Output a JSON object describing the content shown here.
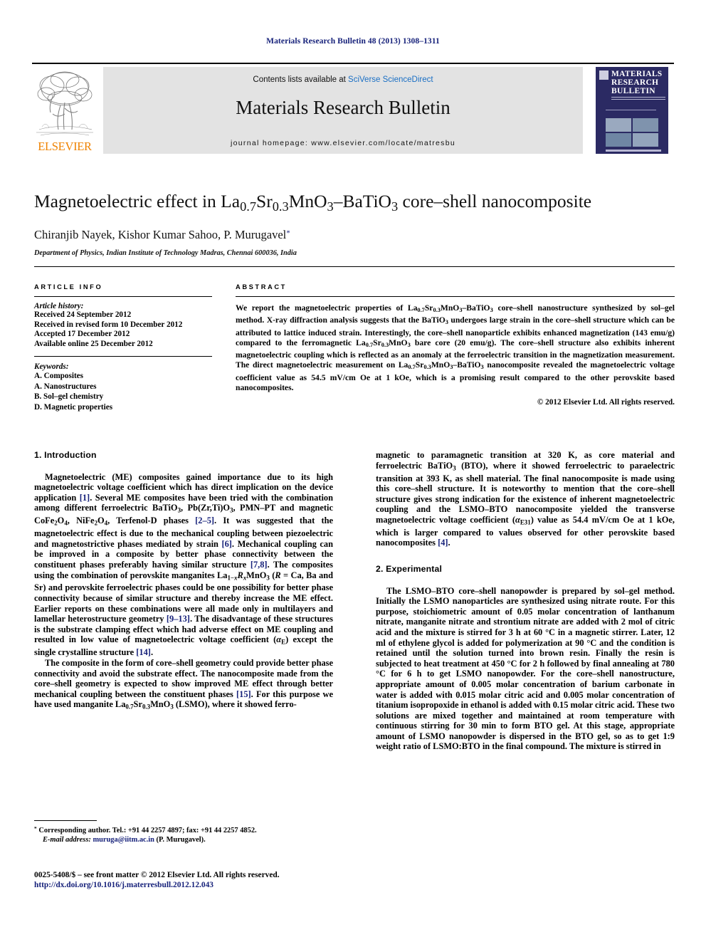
{
  "running_head": "Materials Research Bulletin 48 (2013) 1308–1311",
  "masthead": {
    "contents_prefix": "Contents lists available at ",
    "contents_link": "SciVerse ScienceDirect",
    "journal_title": "Materials Research Bulletin",
    "homepage": "journal homepage: www.elsevier.com/locate/matresbu",
    "publisher_logo_text": "ELSEVIER",
    "cover_title_line1": "MATERIALS",
    "cover_title_line2": "RESEARCH",
    "cover_title_line3": "BULLETIN"
  },
  "article": {
    "title_html": "Magnetoelectric effect in La<sub>0.7</sub>Sr<sub>0.3</sub>MnO<sub>3</sub>–BaTiO<sub>3</sub> core–shell nanocomposite",
    "authors_html": "Chiranjib Nayek, Kishor Kumar Sahoo, P. Murugavel<sup>*</sup>",
    "affiliation": "Department of Physics, Indian Institute of Technology Madras, Chennai 600036, India"
  },
  "article_info": {
    "heading": "ARTICLE INFO",
    "history_label": "Article history:",
    "history": [
      "Received 24 September 2012",
      "Received in revised form 10 December 2012",
      "Accepted 17 December 2012",
      "Available online 25 December 2012"
    ],
    "keywords_label": "Keywords:",
    "keywords": [
      "A. Composites",
      "A. Nanostructures",
      "B. Sol–gel chemistry",
      "D. Magnetic properties"
    ]
  },
  "abstract": {
    "heading": "ABSTRACT",
    "text_html": "We report the magnetoelectric properties of La<sub>0.7</sub>Sr<sub>0.3</sub>MnO<sub>3</sub>–BaTiO<sub>3</sub> core–shell nanostructure synthesized by sol–gel method. X-ray diffraction analysis suggests that the BaTiO<sub>3</sub> undergoes large strain in the core–shell structure which can be attributed to lattice induced strain. Interestingly, the core–shell nanoparticle exhibits enhanced magnetization (143 emu/g) compared to the ferromagnetic La<sub>0.7</sub>Sr<sub>0.3</sub>MnO<sub>3</sub> bare core (20 emu/g). The core–shell structure also exhibits inherent magnetoelectric coupling which is reflected as an anomaly at the ferroelectric transition in the magnetization measurement. The direct magnetoelectric measurement on La<sub>0.7</sub>Sr<sub>0.3</sub>MnO<sub>3</sub>–BaTiO<sub>3</sub> nanocomposite revealed the magnetoelectric voltage coefficient value as 54.5 mV/cm Oe at 1 kOe, which is a promising result compared to the other perovskite based nanocomposites.",
    "copyright": "© 2012 Elsevier Ltd. All rights reserved."
  },
  "sections": {
    "introduction_heading": "1. Introduction",
    "intro_p1_html": "Magnetoelectric (ME) composites gained importance due to its high magnetoelectric voltage coefficient which has direct implication on the device application <span class=\"ref\">[1]</span>. Several ME composites have been tried with the combination among different ferroelectric BaTiO<sub>3</sub>, Pb(Zr,Ti)O<sub>3</sub>, PMN–PT and magnetic CoFe<sub>2</sub>O<sub>4</sub>, NiFe<sub>2</sub>O<sub>4</sub>, Terfenol-D phases <span class=\"ref\">[2–5]</span>. It was suggested that the magnetoelectric effect is due to the mechanical coupling between piezoelectric and magnetostrictive phases mediated by strain <span class=\"ref\">[6]</span>. Mechanical coupling can be improved in a composite by better phase connectivity between the constituent phases preferably having similar structure <span class=\"ref\">[7,8]</span>. The composites using the combination of perovskite manganites La<sub>1−<i>x</i></sub><i>R<sub>x</sub></i>MnO<sub>3</sub> (<i>R</i> = Ca, Ba and Sr) and perovskite ferroelectric phases could be one possibility for better phase connectivity because of similar structure and thereby increase the ME effect. Earlier reports on these combinations were all made only in multilayers and lamellar heterostructure geometry <span class=\"ref\">[9–13]</span>. The disadvantage of these structures is the substrate clamping effect which had adverse effect on ME coupling and resulted in low value of magnetoelectric voltage coefficient (<i>α</i><sub>E</sub>) except the single crystalline structure <span class=\"ref\">[14]</span>.",
    "intro_p2_html": "The composite in the form of core–shell geometry could provide better phase connectivity and avoid the substrate effect. The nanocomposite made from the core–shell geometry is expected to show improved ME effect through better mechanical coupling between the constituent phases <span class=\"ref\">[15]</span>. For this purpose we have used manganite La<sub>0.7</sub>Sr<sub>0.3</sub>MnO<sub>3</sub> (LSMO), where it showed ferro-",
    "intro_p2_cont_html": "magnetic to paramagnetic transition at 320 K, as core material and ferroelectric BaTiO<sub>3</sub> (BTO), where it showed ferroelectric to paraelectric transition at 393 K, as shell material. The final nanocomposite is made using this core–shell structure. It is noteworthy to mention that the core–shell structure gives strong indication for the existence of inherent magnetoelectric coupling and the LSMO–BTO nanocomposite yielded the transverse magnetoelectric voltage coefficient (<i>α</i><sub>E31</sub>) value as 54.4 mV/cm Oe at 1 kOe, which is larger compared to values observed for other perovskite based nanocomposites <span class=\"ref\">[4]</span>.",
    "experimental_heading": "2. Experimental",
    "exp_p1_html": "The LSMO–BTO core–shell nanopowder is prepared by sol–gel method. Initially the LSMO nanoparticles are synthesized using nitrate route. For this purpose, stoichiometric amount of 0.05 molar concentration of lanthanum nitrate, manganite nitrate and strontium nitrate are added with 2 mol of citric acid and the mixture is stirred for 3 h at 60 °C in a magnetic stirrer. Later, 12 ml of ethylene glycol is added for polymerization at 90 °C and the condition is retained until the solution turned into brown resin. Finally the resin is subjected to heat treatment at 450 °C for 2 h followed by final annealing at 780 °C for 6 h to get LSMO nanopowder. For the core–shell nanostructure, appropriate amount of 0.005 molar concentration of barium carbonate in water is added with 0.015 molar citric acid and 0.005 molar concentration of titanium isopropoxide in ethanol is added with 0.15 molar citric acid. These two solutions are mixed together and maintained at room temperature with continuous stirring for 30 min to form BTO gel. At this stage, appropriate amount of LSMO nanopowder is dispersed in the BTO gel, so as to get 1:9 weight ratio of LSMO:BTO in the final compound. The mixture is stirred in"
  },
  "footnote": {
    "marker": "*",
    "corresponding_html": "Corresponding author. Tel.: +91 44 2257 4897; fax: +91 44 2257 4852.",
    "email_label": "E-mail address:",
    "email": "muruga@iitm.ac.in",
    "email_suffix": "(P. Murugavel)."
  },
  "footer": {
    "issn_line": "0025-5408/$ – see front matter © 2012 Elsevier Ltd. All rights reserved.",
    "doi": "http://dx.doi.org/10.1016/j.materresbull.2012.12.043"
  },
  "colors": {
    "link_blue": "#16217a",
    "sciencedirect_blue": "#1a6fc4",
    "elsevier_orange": "#ef8200",
    "cover_navy": "#2b2a63",
    "gray_band": "#e3e3e3"
  }
}
